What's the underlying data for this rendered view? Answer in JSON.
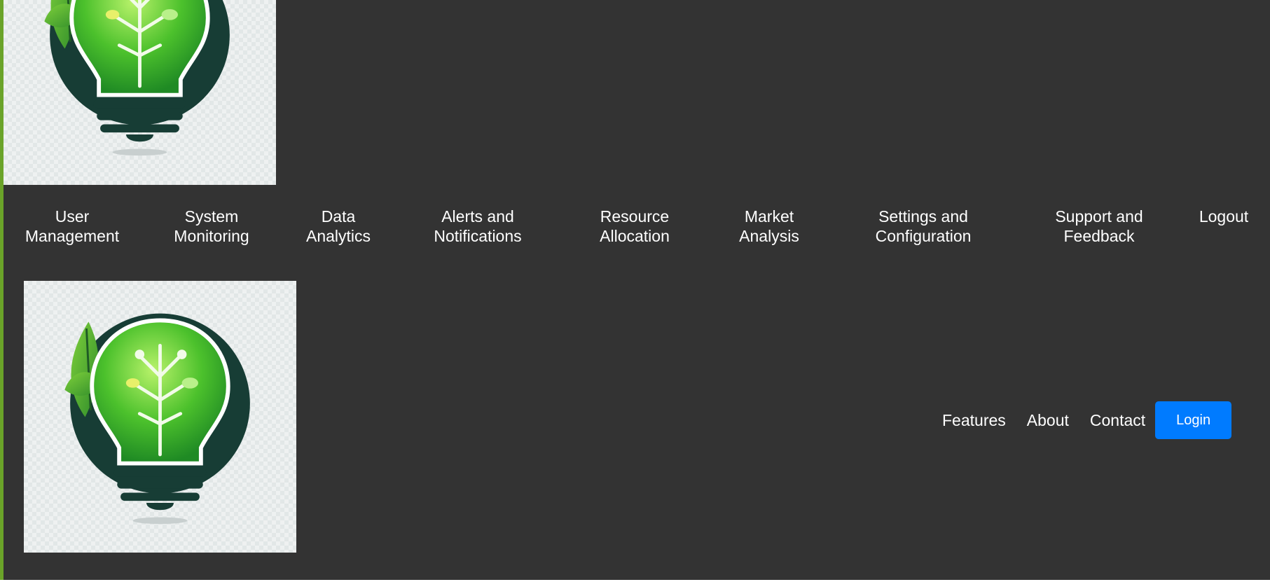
{
  "logo": {
    "icon": "lightbulb-leaf-logo"
  },
  "nav": {
    "items": [
      {
        "label": "User\nManagement"
      },
      {
        "label": "System\nMonitoring"
      },
      {
        "label": "Data\nAnalytics"
      },
      {
        "label": "Alerts and\nNotifications"
      },
      {
        "label": "Resource\nAllocation"
      },
      {
        "label": "Market\nAnalysis"
      },
      {
        "label": "Settings and\nConfiguration"
      },
      {
        "label": "Support and\nFeedback"
      },
      {
        "label": "Logout"
      }
    ]
  },
  "header": {
    "links": [
      {
        "label": "Features"
      },
      {
        "label": "About"
      },
      {
        "label": "Contact"
      }
    ],
    "login_label": "Login"
  },
  "colors": {
    "background": "#333333",
    "accent_border": "#6aa329",
    "login_button": "#007bff",
    "text": "#ffffff"
  }
}
